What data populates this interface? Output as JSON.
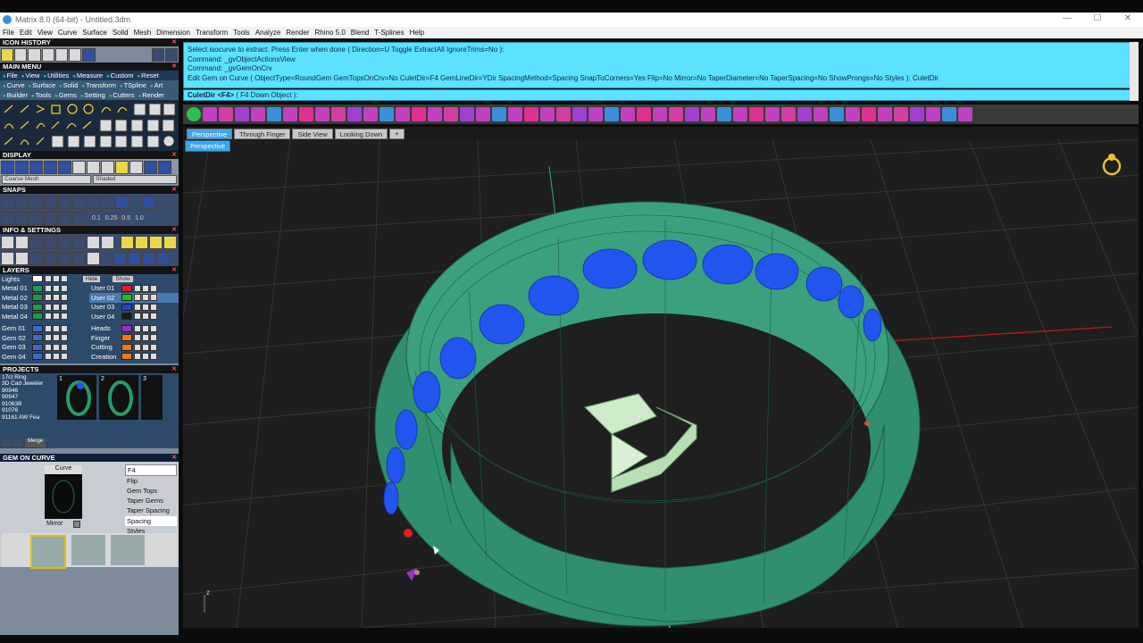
{
  "window": {
    "title": "Matrix 8.0 (64-bit) - Untitled.3dm",
    "controls": [
      "—",
      "☐",
      "✕"
    ]
  },
  "menu": [
    "File",
    "Edit",
    "View",
    "Curve",
    "Surface",
    "Solid",
    "Mesh",
    "Dimension",
    "Transform",
    "Tools",
    "Analyze",
    "Render",
    "Rhino 5.0",
    "Blend",
    "T-Splines",
    "Help"
  ],
  "left": {
    "icon_history": "ICON HISTORY",
    "main_menu": "MAIN MENU",
    "main_menu_row1": [
      "File",
      "View",
      "Utilities",
      "Measure",
      "Custom",
      "Reset"
    ],
    "main_menu_row2": [
      "Curve",
      "Surface",
      "Solid",
      "Transform",
      "TSpline",
      "Art"
    ],
    "main_menu_row3": [
      "Builder",
      "Tools",
      "Gems",
      "Setting",
      "Cutters",
      "Render"
    ],
    "display": "DISPLAY",
    "display_mesh": "Coarse Mesh",
    "display_shade": "Shaded",
    "snaps": "SNAPS",
    "snap_values": [
      "0.1",
      "0.25",
      "0.5",
      "1.0"
    ],
    "info": "INFO & SETTINGS",
    "layers": "LAYERS",
    "lights": "Lights",
    "hide": "Hide",
    "show": "Show",
    "layers_left": [
      "Metal 01",
      "Metal 02",
      "Metal 03",
      "Metal 04"
    ],
    "layers_right": [
      "User 01",
      "User 02",
      "User 03",
      "User 04"
    ],
    "gems_left": [
      "Gem 01",
      "Gem 02",
      "Gem 03",
      "Gem 04"
    ],
    "gems_right": [
      "Heads",
      "Finger",
      "Cutting",
      "Creation"
    ],
    "projects": "PROJECTS",
    "project_list": [
      "17ct Ring",
      "3D Cad Jeweler",
      "90946",
      "90947",
      "91063B",
      "91076",
      "91161 AW Fea"
    ],
    "project_nums": [
      "1",
      "2",
      "3"
    ],
    "merge": "Merge",
    "gem_on_curve": "GEM ON CURVE",
    "curve_label": "Curve",
    "mirror_label": "Mirror",
    "options": [
      {
        "label": "F4"
      },
      {
        "label": "Flip"
      },
      {
        "label": "Gem Tops"
      },
      {
        "label": "Taper Gems"
      },
      {
        "label": "Taper Spacing"
      },
      {
        "label": "Spacing"
      },
      {
        "label": "Styles"
      }
    ]
  },
  "command": {
    "lines": [
      "Select isocurve to extract. Press Enter when done ( Direction=U  Toggle  ExtractAll  IgnoreTrims=No ):",
      "Command: _gvObjectActionsView",
      "Command: _gvGemOnCrv",
      "Edit Gem on Curve ( ObjectType=RoundGem  GemTopsOnCrv=No  CuletDir=F4  GemLineDir=YDir  SpacingMethod=Spacing  SnapToCorners=Yes  Flip=No  Mirror=No  TaperDiameter=No  TaperSpacing=No  ShowProngs=No  Styles ): CuletDir"
    ],
    "prompt_bold": "CuletDir <F4>",
    "prompt_rest": " ( F4  Down  Object ):"
  },
  "tabs": [
    "Perspective",
    "Through Finger",
    "Side View",
    "Looking Down",
    "+"
  ],
  "viewport_label": "Perspective",
  "axis_label": "z",
  "colors": {
    "cmd_bg": "#5ce1ff",
    "ring": "#2f8f6e",
    "gem": "#2255ee",
    "tab_active": "#3fa6e8"
  }
}
